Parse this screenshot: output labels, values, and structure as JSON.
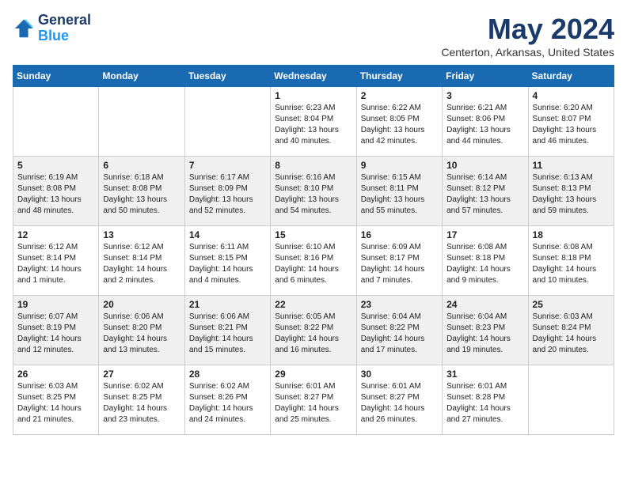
{
  "app": {
    "logo_line1": "General",
    "logo_line2": "Blue"
  },
  "calendar": {
    "title": "May 2024",
    "subtitle": "Centerton, Arkansas, United States",
    "days_of_week": [
      "Sunday",
      "Monday",
      "Tuesday",
      "Wednesday",
      "Thursday",
      "Friday",
      "Saturday"
    ],
    "weeks": [
      [
        {
          "day": "",
          "info": ""
        },
        {
          "day": "",
          "info": ""
        },
        {
          "day": "",
          "info": ""
        },
        {
          "day": "1",
          "info": "Sunrise: 6:23 AM\nSunset: 8:04 PM\nDaylight: 13 hours\nand 40 minutes."
        },
        {
          "day": "2",
          "info": "Sunrise: 6:22 AM\nSunset: 8:05 PM\nDaylight: 13 hours\nand 42 minutes."
        },
        {
          "day": "3",
          "info": "Sunrise: 6:21 AM\nSunset: 8:06 PM\nDaylight: 13 hours\nand 44 minutes."
        },
        {
          "day": "4",
          "info": "Sunrise: 6:20 AM\nSunset: 8:07 PM\nDaylight: 13 hours\nand 46 minutes."
        }
      ],
      [
        {
          "day": "5",
          "info": "Sunrise: 6:19 AM\nSunset: 8:08 PM\nDaylight: 13 hours\nand 48 minutes."
        },
        {
          "day": "6",
          "info": "Sunrise: 6:18 AM\nSunset: 8:08 PM\nDaylight: 13 hours\nand 50 minutes."
        },
        {
          "day": "7",
          "info": "Sunrise: 6:17 AM\nSunset: 8:09 PM\nDaylight: 13 hours\nand 52 minutes."
        },
        {
          "day": "8",
          "info": "Sunrise: 6:16 AM\nSunset: 8:10 PM\nDaylight: 13 hours\nand 54 minutes."
        },
        {
          "day": "9",
          "info": "Sunrise: 6:15 AM\nSunset: 8:11 PM\nDaylight: 13 hours\nand 55 minutes."
        },
        {
          "day": "10",
          "info": "Sunrise: 6:14 AM\nSunset: 8:12 PM\nDaylight: 13 hours\nand 57 minutes."
        },
        {
          "day": "11",
          "info": "Sunrise: 6:13 AM\nSunset: 8:13 PM\nDaylight: 13 hours\nand 59 minutes."
        }
      ],
      [
        {
          "day": "12",
          "info": "Sunrise: 6:12 AM\nSunset: 8:14 PM\nDaylight: 14 hours\nand 1 minute."
        },
        {
          "day": "13",
          "info": "Sunrise: 6:12 AM\nSunset: 8:14 PM\nDaylight: 14 hours\nand 2 minutes."
        },
        {
          "day": "14",
          "info": "Sunrise: 6:11 AM\nSunset: 8:15 PM\nDaylight: 14 hours\nand 4 minutes."
        },
        {
          "day": "15",
          "info": "Sunrise: 6:10 AM\nSunset: 8:16 PM\nDaylight: 14 hours\nand 6 minutes."
        },
        {
          "day": "16",
          "info": "Sunrise: 6:09 AM\nSunset: 8:17 PM\nDaylight: 14 hours\nand 7 minutes."
        },
        {
          "day": "17",
          "info": "Sunrise: 6:08 AM\nSunset: 8:18 PM\nDaylight: 14 hours\nand 9 minutes."
        },
        {
          "day": "18",
          "info": "Sunrise: 6:08 AM\nSunset: 8:18 PM\nDaylight: 14 hours\nand 10 minutes."
        }
      ],
      [
        {
          "day": "19",
          "info": "Sunrise: 6:07 AM\nSunset: 8:19 PM\nDaylight: 14 hours\nand 12 minutes."
        },
        {
          "day": "20",
          "info": "Sunrise: 6:06 AM\nSunset: 8:20 PM\nDaylight: 14 hours\nand 13 minutes."
        },
        {
          "day": "21",
          "info": "Sunrise: 6:06 AM\nSunset: 8:21 PM\nDaylight: 14 hours\nand 15 minutes."
        },
        {
          "day": "22",
          "info": "Sunrise: 6:05 AM\nSunset: 8:22 PM\nDaylight: 14 hours\nand 16 minutes."
        },
        {
          "day": "23",
          "info": "Sunrise: 6:04 AM\nSunset: 8:22 PM\nDaylight: 14 hours\nand 17 minutes."
        },
        {
          "day": "24",
          "info": "Sunrise: 6:04 AM\nSunset: 8:23 PM\nDaylight: 14 hours\nand 19 minutes."
        },
        {
          "day": "25",
          "info": "Sunrise: 6:03 AM\nSunset: 8:24 PM\nDaylight: 14 hours\nand 20 minutes."
        }
      ],
      [
        {
          "day": "26",
          "info": "Sunrise: 6:03 AM\nSunset: 8:25 PM\nDaylight: 14 hours\nand 21 minutes."
        },
        {
          "day": "27",
          "info": "Sunrise: 6:02 AM\nSunset: 8:25 PM\nDaylight: 14 hours\nand 23 minutes."
        },
        {
          "day": "28",
          "info": "Sunrise: 6:02 AM\nSunset: 8:26 PM\nDaylight: 14 hours\nand 24 minutes."
        },
        {
          "day": "29",
          "info": "Sunrise: 6:01 AM\nSunset: 8:27 PM\nDaylight: 14 hours\nand 25 minutes."
        },
        {
          "day": "30",
          "info": "Sunrise: 6:01 AM\nSunset: 8:27 PM\nDaylight: 14 hours\nand 26 minutes."
        },
        {
          "day": "31",
          "info": "Sunrise: 6:01 AM\nSunset: 8:28 PM\nDaylight: 14 hours\nand 27 minutes."
        },
        {
          "day": "",
          "info": ""
        }
      ]
    ]
  }
}
